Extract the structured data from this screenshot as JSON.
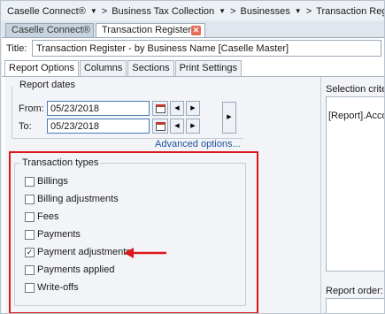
{
  "breadcrumb": {
    "root": "Caselle Connect®",
    "items": [
      "Business Tax Collection",
      "Businesses",
      "Transaction Register"
    ]
  },
  "doc_tabs": {
    "inactive": "Caselle Connect®",
    "active": "Transaction Register"
  },
  "title": {
    "label": "Title:",
    "value": "Transaction Register - by Business Name [Caselle Master]"
  },
  "subtabs": [
    "Report Options",
    "Columns",
    "Sections",
    "Print Settings"
  ],
  "report_dates": {
    "legend": "Report dates",
    "from_label": "From:",
    "from_value": "05/23/2018",
    "to_label": "To:",
    "to_value": "05/23/2018",
    "advanced_link": "Advanced options..."
  },
  "transaction_types": {
    "legend": "Transaction types",
    "items": [
      {
        "label": "Billings",
        "checked": false
      },
      {
        "label": "Billing adjustments",
        "checked": false
      },
      {
        "label": "Fees",
        "checked": false
      },
      {
        "label": "Payments",
        "checked": false
      },
      {
        "label": "Payment adjustments",
        "checked": true
      },
      {
        "label": "Payments applied",
        "checked": false
      },
      {
        "label": "Write-offs",
        "checked": false
      }
    ]
  },
  "selection": {
    "label": "Selection criteria:",
    "text": "[Report].Accour"
  },
  "report_order": {
    "label": "Report order:"
  },
  "colors": {
    "highlight": "#e0161d",
    "link": "#1f4f9a"
  }
}
